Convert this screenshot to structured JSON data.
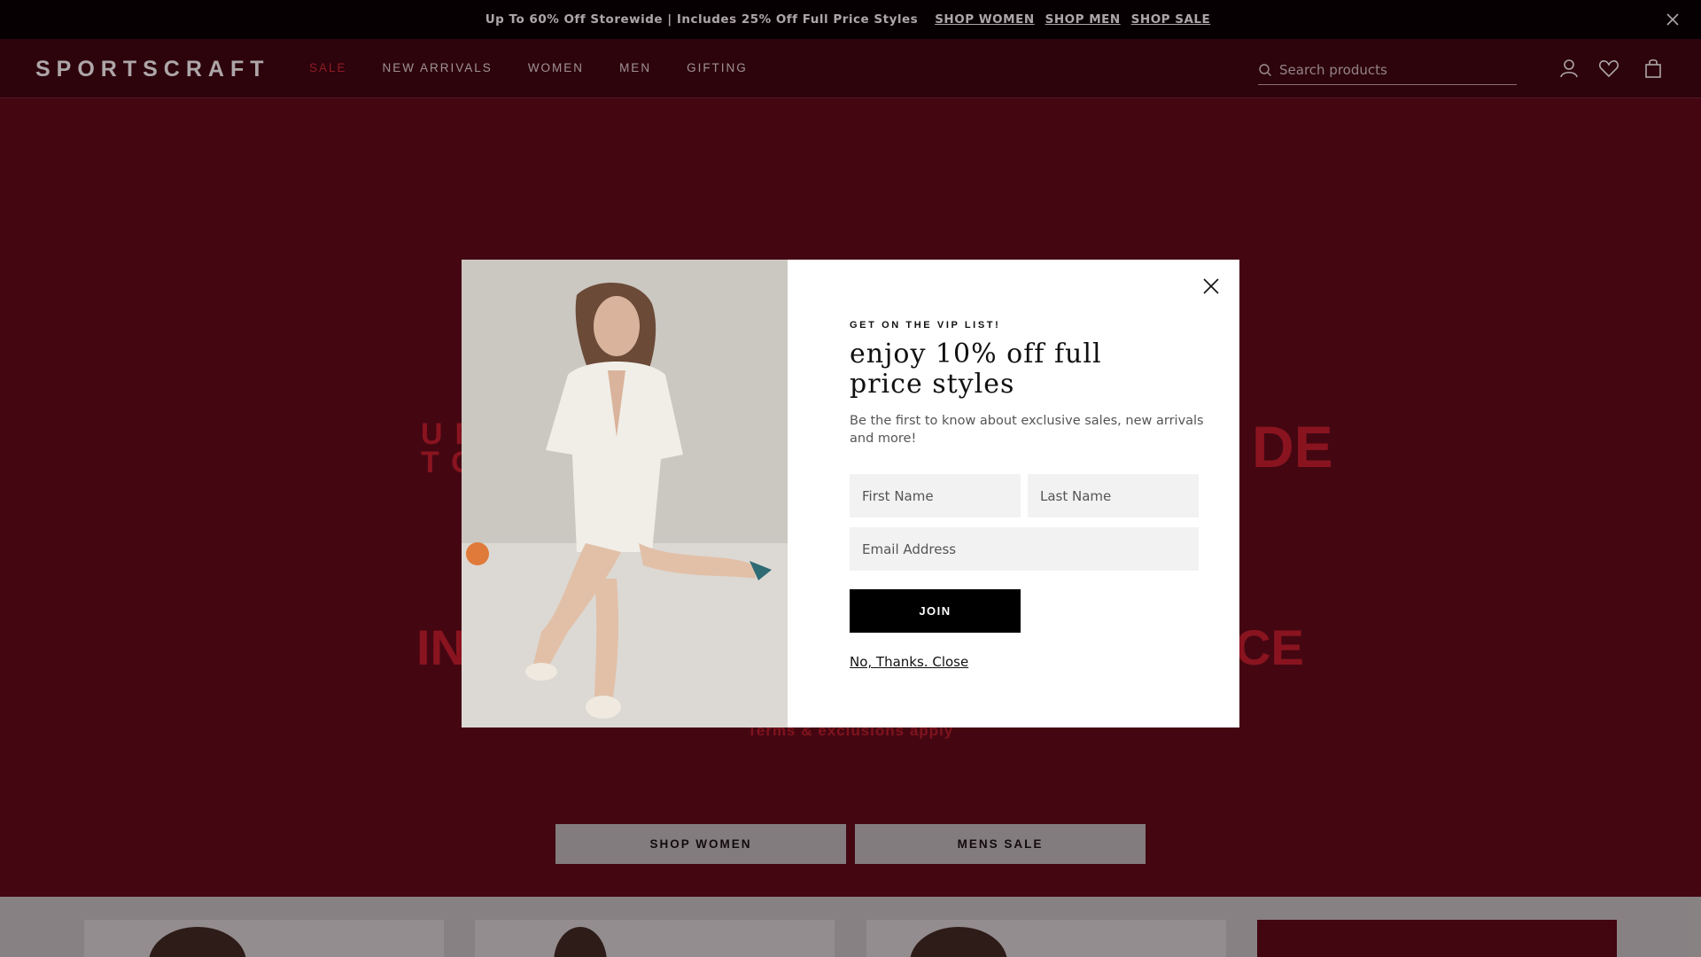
{
  "promo_bar": {
    "text": "Up To 60% Off Storewide | Includes 25% Off Full Price Styles",
    "links": [
      "SHOP WOMEN",
      "SHOP MEN",
      "SHOP SALE"
    ]
  },
  "header": {
    "logo": "SPORTSCRAFT",
    "nav": [
      "SALE",
      "NEW ARRIVALS",
      "WOMEN",
      "MEN",
      "GIFTING"
    ],
    "search_placeholder": "Search products",
    "icons": [
      "account-icon",
      "wishlist-icon",
      "bag-icon"
    ]
  },
  "hero": {
    "line1_left": "UP\nTO",
    "line1_right": "DE",
    "line2_left": "IN",
    "line2_right": "CE",
    "terms": "Terms & exclusions apply",
    "buttons": [
      "SHOP WOMEN",
      "MENS SALE"
    ]
  },
  "modal": {
    "eyebrow": "GET ON THE VIP LIST!",
    "headline": "enjoy 10% off full price styles",
    "sub": "Be the first to know about exclusive sales, new arrivals and more!",
    "first_name_placeholder": "First Name",
    "last_name_placeholder": "Last Name",
    "email_placeholder": "Email Address",
    "join_label": "JOIN",
    "no_thanks": "No, Thanks. Close"
  },
  "colors": {
    "brand_maroon": "#5e0b19",
    "sale_red": "#d22b35",
    "hero_red": "#c81f2d"
  }
}
